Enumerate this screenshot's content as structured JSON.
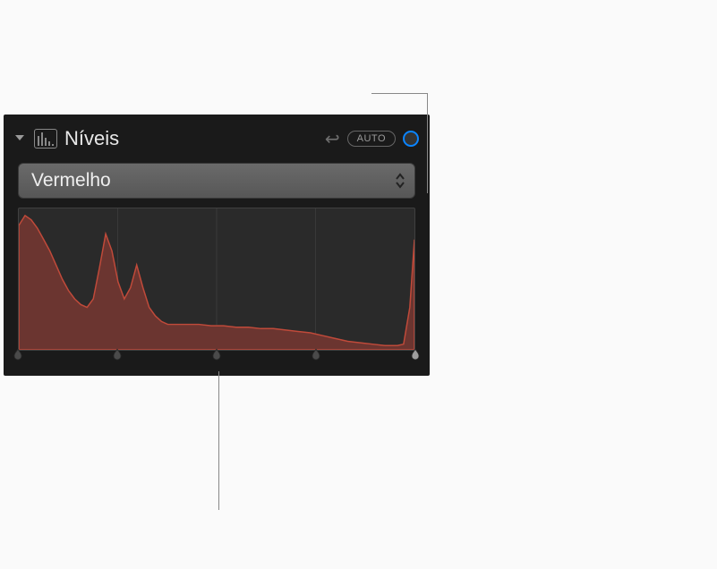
{
  "panel": {
    "title": "Níveis",
    "reset_glyph": "↩",
    "auto_label": "AUTO"
  },
  "channel": {
    "selected": "Vermelho"
  },
  "histogram": {
    "color": "#c04a3a",
    "fill": "#6b3530",
    "grid_positions": [
      0.25,
      0.5,
      0.75
    ],
    "handle_positions": [
      0.0,
      0.25,
      0.5,
      0.75,
      1.0
    ]
  },
  "chart_data": {
    "type": "area",
    "title": "",
    "xlabel": "",
    "ylabel": "",
    "xlim": [
      0,
      255
    ],
    "ylim": [
      0,
      100
    ],
    "series": [
      {
        "name": "Vermelho",
        "x": [
          0,
          4,
          8,
          12,
          16,
          20,
          24,
          28,
          32,
          36,
          40,
          44,
          48,
          52,
          56,
          60,
          64,
          68,
          72,
          76,
          80,
          84,
          88,
          92,
          96,
          100,
          108,
          116,
          124,
          132,
          140,
          148,
          156,
          164,
          172,
          180,
          188,
          196,
          204,
          212,
          220,
          228,
          236,
          244,
          248,
          252,
          255
        ],
        "values": [
          88,
          95,
          92,
          86,
          78,
          70,
          60,
          50,
          42,
          36,
          32,
          30,
          36,
          58,
          82,
          70,
          48,
          36,
          44,
          60,
          44,
          30,
          24,
          20,
          18,
          18,
          18,
          18,
          17,
          17,
          16,
          16,
          15,
          15,
          14,
          13,
          12,
          10,
          8,
          6,
          5,
          4,
          3,
          3,
          4,
          30,
          78
        ]
      }
    ]
  }
}
